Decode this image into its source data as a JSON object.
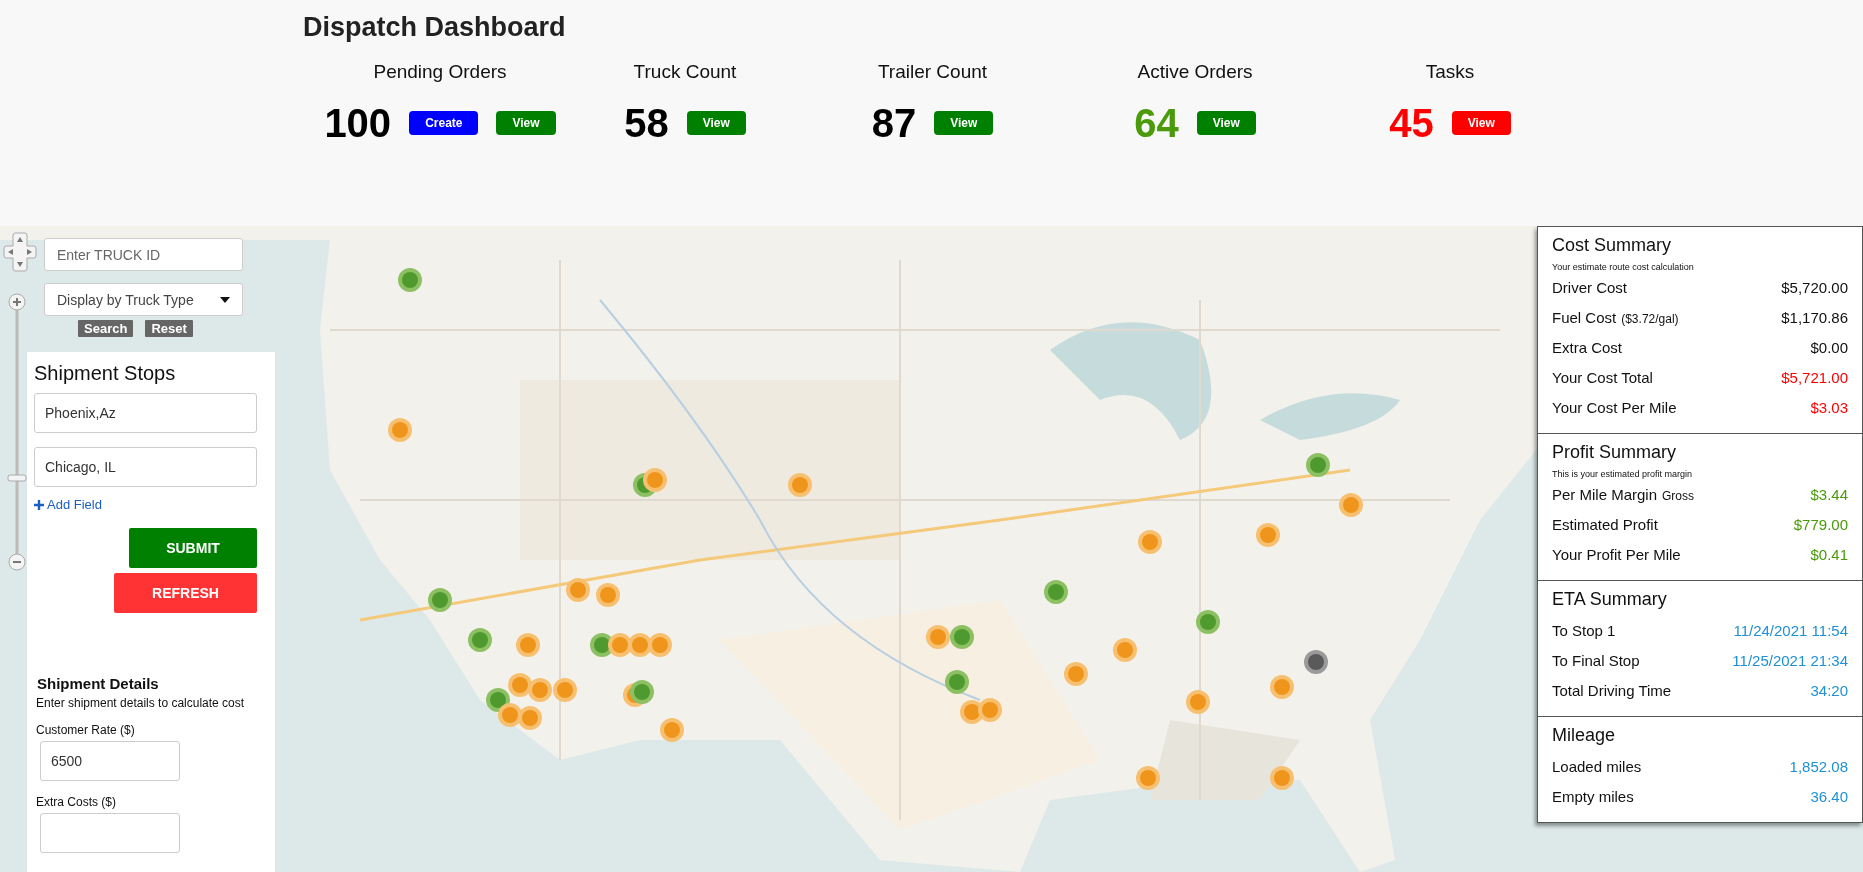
{
  "header": {
    "title": "Dispatch Dashboard"
  },
  "stats": [
    {
      "label": "Pending Orders",
      "value": "100",
      "color": "#000000",
      "buttons": [
        {
          "label": "Create",
          "color": "#0000ff"
        },
        {
          "label": "View",
          "color": "#008000"
        }
      ]
    },
    {
      "label": "Truck Count",
      "value": "58",
      "color": "#000000",
      "buttons": [
        {
          "label": "View",
          "color": "#008000"
        }
      ]
    },
    {
      "label": "Trailer Count",
      "value": "87",
      "color": "#000000",
      "buttons": [
        {
          "label": "View",
          "color": "#008000"
        }
      ]
    },
    {
      "label": "Active Orders",
      "value": "64",
      "color": "#4a9a0a",
      "buttons": [
        {
          "label": "View",
          "color": "#008000"
        }
      ]
    },
    {
      "label": "Tasks",
      "value": "45",
      "color": "#ff0000",
      "buttons": [
        {
          "label": "View",
          "color": "#ff0000"
        }
      ]
    }
  ],
  "truck_search": {
    "placeholder": "Enter TRUCK ID",
    "truck_type": "Display by Truck Type",
    "search_button": "Search",
    "reset_button": "Reset"
  },
  "shipment_stops": {
    "title": "Shipment Stops",
    "stops": [
      "Phoenix,Az",
      "Chicago, IL"
    ],
    "add_field": "Add Field",
    "submit": "SUBMIT",
    "refresh": "REFRESH"
  },
  "shipment_details": {
    "title": "Shipment Details",
    "description": "Enter shipment details to calculate cost",
    "fields": [
      {
        "label": "Customer Rate ($)",
        "value": "6500"
      },
      {
        "label": "Extra Costs ($)"
      }
    ]
  },
  "summary": [
    {
      "title": "Cost Summary",
      "subtitle": "Your estimate route cost calculation",
      "rows": [
        {
          "label": "Driver Cost",
          "value": "$5,720.00",
          "color": "#111111"
        },
        {
          "label": "Fuel Cost",
          "note": "($3.72/gal)",
          "value": "$1,170.86",
          "color": "#111111"
        },
        {
          "label": "Extra Cost",
          "value": "$0.00",
          "color": "#111111"
        },
        {
          "label": "Your Cost Total",
          "value": "$5,721.00",
          "color": "#ff0000"
        },
        {
          "label": "Your Cost Per Mile",
          "value": "$3.03",
          "color": "#ff0000"
        }
      ]
    },
    {
      "title": "Profit Summary",
      "subtitle": "This is your estimated profit margin",
      "rows": [
        {
          "label": "Per Mile Margin",
          "note": "Gross",
          "value": "$3.44",
          "color": "#4a9a0a"
        },
        {
          "label": "Estimated Profit",
          "value": "$779.00",
          "color": "#4a9a0a"
        },
        {
          "label": "Your Profit Per Mile",
          "value": "$0.41",
          "color": "#4a9a0a"
        }
      ]
    },
    {
      "title": "ETA Summary",
      "rows": [
        {
          "label": "To Stop 1",
          "value": "11/24/2021 11:54",
          "color": "#1e90d6"
        },
        {
          "label": "To Final Stop",
          "value": "11/25/2021 21:34",
          "color": "#1e90d6"
        },
        {
          "label": "Total Driving Time",
          "value": "34:20",
          "color": "#1e90d6"
        }
      ]
    },
    {
      "title": "Mileage",
      "rows": [
        {
          "label": "Loaded miles",
          "value": "1,852.08",
          "color": "#1e90d6"
        },
        {
          "label": "Empty miles",
          "value": "36.40",
          "color": "#1e90d6"
        }
      ]
    }
  ]
}
